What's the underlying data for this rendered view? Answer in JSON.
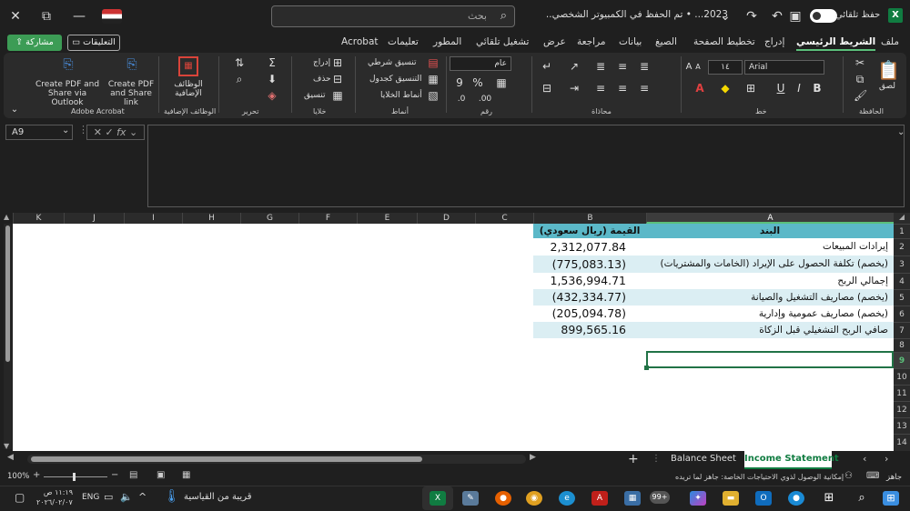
{
  "window": {
    "title": "2023... • تم الحفظ في الكمبيوتر الشخصي...",
    "search_placeholder": "بحث",
    "autosave_label": "حفظ تلقائي",
    "close_glyph": "✕",
    "maximize_glyph": "⧉",
    "minimize_glyph": "—"
  },
  "menu": {
    "share": "مشاركة",
    "comments": "التعليقات",
    "tabs": [
      "ملف",
      "الشريط الرئيسي",
      "إدراج",
      "تخطيط الصفحة",
      "الصيغ",
      "بيانات",
      "مراجعة",
      "عرض",
      "تشغيل تلقائي",
      "المطور",
      "تعليمات",
      "Acrobat"
    ]
  },
  "ribbon": {
    "clipboard": "الحافظة",
    "paste": "لصق",
    "font": "خط",
    "font_name": "Arial",
    "font_size": "١٤",
    "alignment": "محاذاة",
    "number": "رقم",
    "number_format": "عام",
    "styles": "أنماط",
    "conditional": "تنسيق شرطي",
    "format_table": "التنسيق كجدول",
    "cell_styles": "أنماط الخلايا",
    "cells": "خلايا",
    "insert": "إدراج",
    "delete": "حذف",
    "format": "تنسيق",
    "editing": "تحرير",
    "addins": "الوظائف الإضافية",
    "addins_btn": "الوظائف الإضافية",
    "acrobat_group": "Adobe Acrobat",
    "create_pdf_share": "Create PDF and Share link",
    "create_pdf_outlook": "Create PDF and Share via Outlook"
  },
  "formula_bar": {
    "name_box": "A9",
    "fx": "fx"
  },
  "grid": {
    "columns": [
      "A",
      "B",
      "C",
      "D",
      "E",
      "F",
      "G",
      "H",
      "I",
      "J",
      "K"
    ],
    "rows": [
      "1",
      "2",
      "3",
      "4",
      "5",
      "6",
      "7",
      "8",
      "9",
      "10",
      "11",
      "12",
      "13",
      "14"
    ],
    "selected_row": "9",
    "table": {
      "header_item": "البند",
      "header_value": "القيمة (ريال سعودي)",
      "rows": [
        {
          "item": "إيرادات المبيعات",
          "value": "2,312,077.84"
        },
        {
          "item": "(يخصم) تكلفة الحصول على الإيراد (الخامات والمشتريات)",
          "value": "(775,083.13)"
        },
        {
          "item": "إجمالي الربح",
          "value": "1,536,994.71"
        },
        {
          "item": "(يخصم) مصاريف التشغيل والصيانة",
          "value": "(432,334.77)"
        },
        {
          "item": "(يخصم) مصاريف عمومية وإدارية",
          "value": "(205,094.78)"
        },
        {
          "item": "صافي الربح التشغيلي قبل الزكاة",
          "value": "899,565.16"
        }
      ]
    }
  },
  "sheets": {
    "tab1": "Balance Sheet",
    "tab2": "Income Statement"
  },
  "status": {
    "ready": "جاهز",
    "accessibility": "إمكانية الوصول لذوي الاحتياجات الخاصة: جاهز لما تريده",
    "zoom": "100%"
  },
  "taskbar": {
    "weather": "قريبة من القياسية",
    "lang": "ENG",
    "time": "١١:١٩ ص",
    "date": "٢٠٢٦/٠٢/٠٧",
    "badge": "99+"
  },
  "colors": {
    "header_fill": "#5bb8c8",
    "band_fill": "#dbeef3",
    "accent": "#107c41"
  }
}
